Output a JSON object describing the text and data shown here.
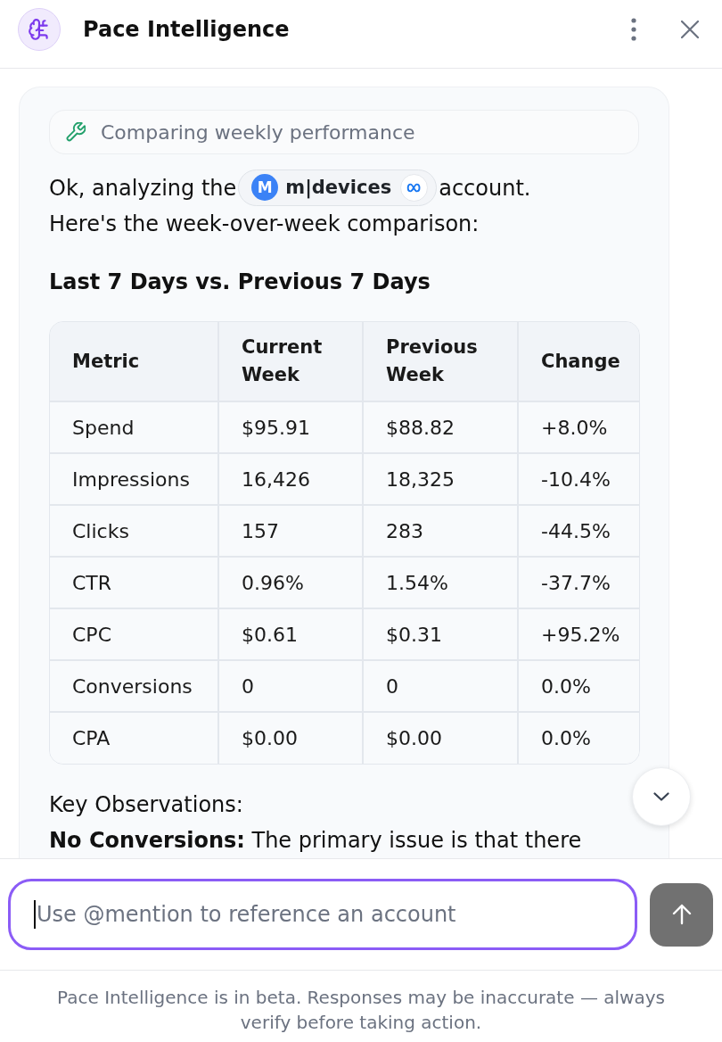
{
  "header": {
    "title": "Pace Intelligence"
  },
  "message": {
    "tool_status": {
      "label": "Comparing weekly performance"
    },
    "intro": {
      "before": "Ok, analyzing the",
      "account": {
        "initial": "M",
        "name": "m|devices"
      },
      "after": "account.",
      "next_line": "Here's the week-over-week comparison:"
    },
    "heading": "Last 7 Days vs. Previous 7 Days",
    "table": {
      "columns": [
        "Metric",
        "Current Week",
        "Previous Week",
        "Change"
      ],
      "rows": [
        [
          "Spend",
          "$95.91",
          "$88.82",
          "+8.0%"
        ],
        [
          "Impressions",
          "16,426",
          "18,325",
          "-10.4%"
        ],
        [
          "Clicks",
          "157",
          "283",
          "-44.5%"
        ],
        [
          "CTR",
          "0.96%",
          "1.54%",
          "-37.7%"
        ],
        [
          "CPC",
          "$0.61",
          "$0.31",
          "+95.2%"
        ],
        [
          "Conversions",
          "0",
          "0",
          "0.0%"
        ],
        [
          "CPA",
          "$0.00",
          "$0.00",
          "0.0%"
        ]
      ]
    },
    "observations_title": "Key Observations:",
    "observation": "**No Conversions:** The primary issue is that there"
  },
  "composer": {
    "placeholder": "Use @mention to reference an account",
    "focused": true,
    "send_disabled": true
  },
  "disclaimer": "Pace Intelligence is in beta. Responses may be inaccurate — always verify before taking action."
}
